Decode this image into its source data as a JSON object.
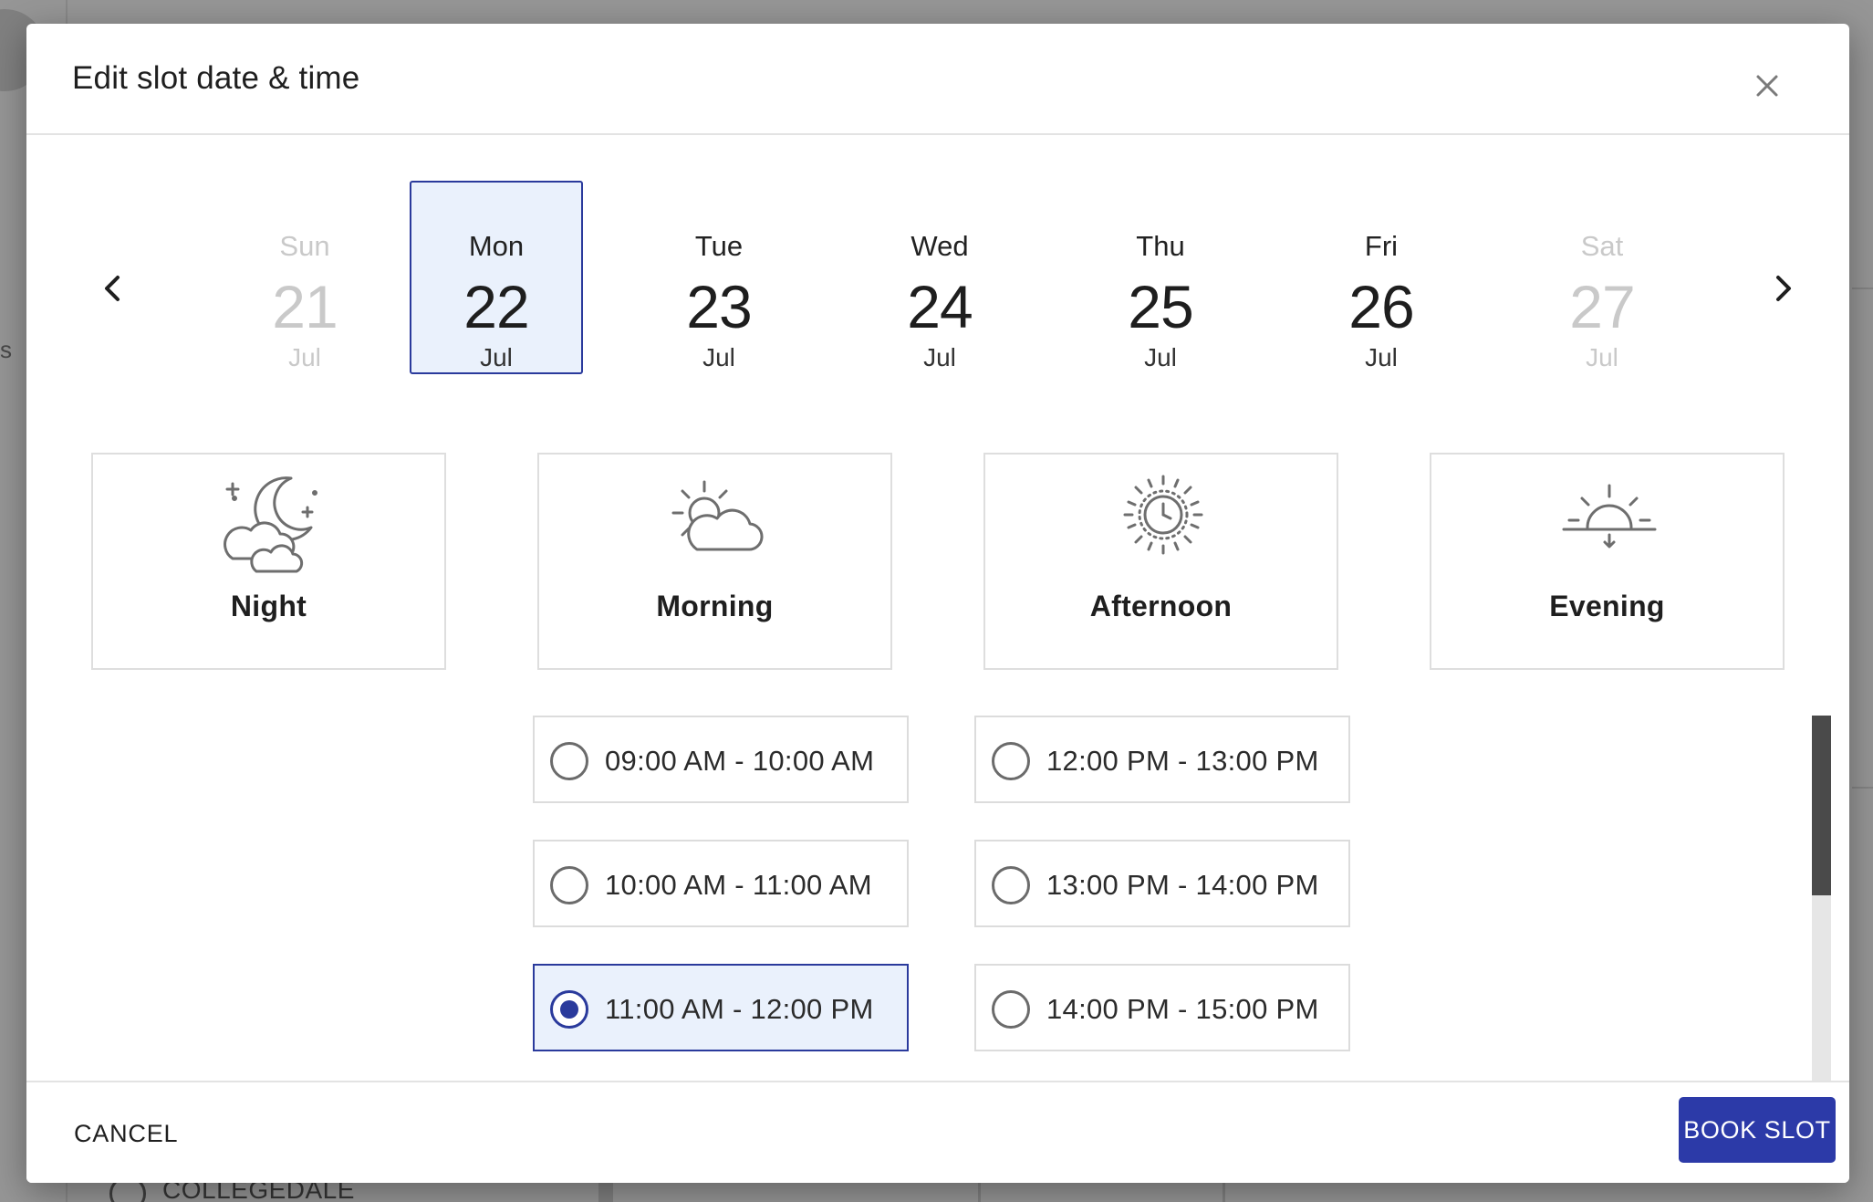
{
  "background": {
    "partial_text": "s",
    "list_item_label": "COLLEGEDALE"
  },
  "dialog": {
    "title": "Edit slot date & time",
    "close_icon": "close-icon"
  },
  "days": [
    {
      "name": "Sun",
      "num": "21",
      "month": "Jul",
      "state": "disabled"
    },
    {
      "name": "Mon",
      "num": "22",
      "month": "Jul",
      "state": "selected"
    },
    {
      "name": "Tue",
      "num": "23",
      "month": "Jul",
      "state": "normal"
    },
    {
      "name": "Wed",
      "num": "24",
      "month": "Jul",
      "state": "normal"
    },
    {
      "name": "Thu",
      "num": "25",
      "month": "Jul",
      "state": "normal"
    },
    {
      "name": "Fri",
      "num": "26",
      "month": "Jul",
      "state": "normal"
    },
    {
      "name": "Sat",
      "num": "27",
      "month": "Jul",
      "state": "disabled"
    }
  ],
  "periods": [
    {
      "label": "Night",
      "icon": "moon-cloud-icon"
    },
    {
      "label": "Morning",
      "icon": "sun-cloud-icon"
    },
    {
      "label": "Afternoon",
      "icon": "sun-clock-icon"
    },
    {
      "label": "Evening",
      "icon": "sunset-icon"
    }
  ],
  "slots": {
    "morning": [
      {
        "label": "09:00 AM - 10:00 AM",
        "selected": false
      },
      {
        "label": "10:00 AM - 11:00 AM",
        "selected": false
      },
      {
        "label": "11:00 AM - 12:00 PM",
        "selected": true
      }
    ],
    "afternoon": [
      {
        "label": "12:00 PM - 13:00 PM",
        "selected": false
      },
      {
        "label": "13:00 PM - 14:00 PM",
        "selected": false
      },
      {
        "label": "14:00 PM - 15:00 PM",
        "selected": false
      }
    ]
  },
  "footer": {
    "cancel_label": "CANCEL",
    "book_label": "BOOK SLOT"
  },
  "colors": {
    "accent": "#2c3aa8",
    "selected_bg": "#eaf1fc",
    "muted_text": "#c9c9c9"
  }
}
